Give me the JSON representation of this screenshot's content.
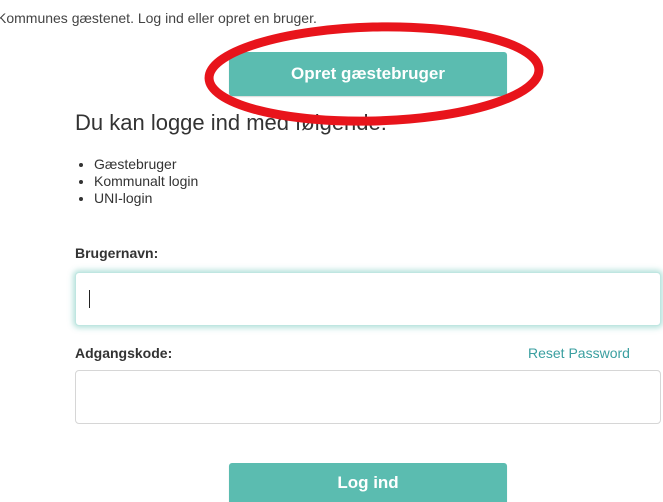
{
  "intro_text": "Kommunes gæstenet. Log ind eller opret en bruger.",
  "create_guest_button": "Opret gæstebruger",
  "login_options_heading": "Du kan logge ind med følgende:",
  "login_methods": [
    "Gæstebruger",
    "Kommunalt login",
    "UNI-login"
  ],
  "username_label": "Brugernavn:",
  "username_value": "",
  "password_label": "Adgangskode:",
  "password_value": "",
  "reset_password_link": "Reset Password",
  "login_button": "Log ind",
  "colors": {
    "accent": "#5bbcb0",
    "link": "#3a9fa0",
    "annotation": "#e8141b"
  }
}
